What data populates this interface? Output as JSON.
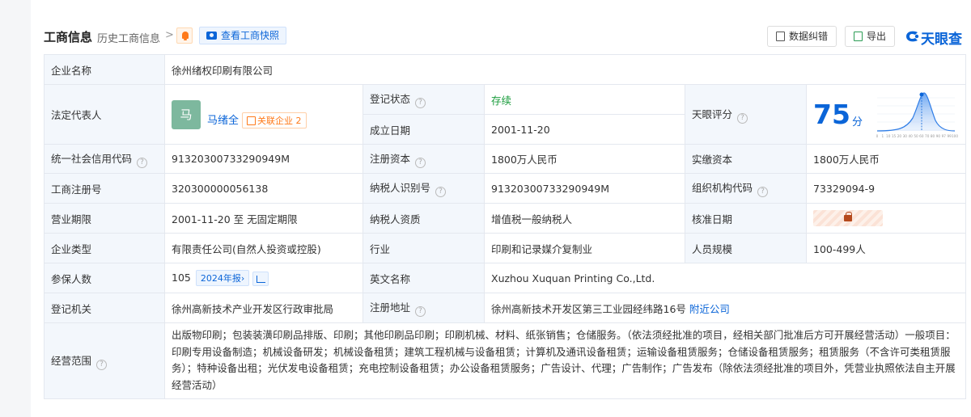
{
  "header": {
    "title": "工商信息",
    "history": "历史工商信息",
    "chevron": ">",
    "snapshot": "查看工商快照",
    "correct": "数据纠错",
    "export": "导出",
    "brand": "天眼查"
  },
  "rows": {
    "name_label": "企业名称",
    "name_value": "徐州绪权印刷有限公司",
    "rep_label": "法定代表人",
    "rep_avatar": "马",
    "rep_name": "马绪全",
    "rep_related": "关联企业",
    "rep_related_count": "2",
    "status_label": "登记状态",
    "status_value": "存续",
    "founded_label": "成立日期",
    "founded_value": "2001-11-20",
    "score_label": "天眼评分",
    "score_value": "75",
    "score_unit": "分",
    "credit_label": "统一社会信用代码",
    "credit_value": "91320300733290949M",
    "capital_label": "注册资本",
    "capital_value": "1800万人民币",
    "paid_label": "实缴资本",
    "paid_value": "1800万人民币",
    "reg_label": "工商注册号",
    "reg_value": "320300000056138",
    "tax_label": "纳税人识别号",
    "tax_value": "91320300733290949M",
    "org_label": "组织机构代码",
    "org_value": "73329094-9",
    "term_label": "营业期限",
    "term_value": "2001-11-20 至 无固定期限",
    "taxq_label": "纳税人资质",
    "taxq_value": "增值税一般纳税人",
    "approve_label": "核准日期",
    "type_label": "企业类型",
    "type_value": "有限责任公司(自然人投资或控股)",
    "industry_label": "行业",
    "industry_value": "印刷和记录媒介复制业",
    "staff_label": "人员规模",
    "staff_value": "100-499人",
    "insured_label": "参保人数",
    "insured_value": "105",
    "insured_report": "2024年报",
    "insured_report_arrow": "›",
    "en_label": "英文名称",
    "en_value": "Xuzhou Xuquan Printing Co.,Ltd.",
    "authority_label": "登记机关",
    "authority_value": "徐州高新技术产业开发区行政审批局",
    "address_label": "注册地址",
    "address_value": "徐州高新技术开发区第三工业园经纬路16号",
    "address_nearby": "附近公司",
    "scope_label": "经营范围",
    "scope_value": "出版物印刷；包装装潢印刷品排版、印刷；其他印刷品印刷；印刷机械、材料、纸张销售；仓储服务。（依法须经批准的项目，经相关部门批准后方可开展经营活动）一般项目：印刷专用设备制造；机械设备研发；机械设备租赁；建筑工程机械与设备租赁；计算机及通讯设备租赁；运输设备租赁服务；仓储设备租赁服务；租赁服务（不含许可类租赁服务）；特种设备出租；光伏发电设备租赁；充电控制设备租赁；办公设备租赁服务；广告设计、代理；广告制作；广告发布（除依法须经批准的项目外，凭营业执照依法自主开展经营活动）"
  },
  "score_axis": [
    "0",
    "1",
    "10",
    "15",
    "20",
    "30",
    "40",
    "50",
    "60",
    "70",
    "80",
    "90",
    "97",
    "99",
    "100"
  ],
  "colors": {
    "accent": "#0b65d8",
    "status_green": "#1a9c3c",
    "label_bg": "#f3f7fc",
    "warn": "#ff7a1a"
  },
  "icons": {
    "bell": "bell-icon",
    "camera": "camera-icon",
    "correct": "edit-doc-icon",
    "export": "excel-icon",
    "help": "help-circle-icon",
    "related": "network-icon",
    "trend": "trend-chart-icon",
    "lock": "lock-icon"
  }
}
